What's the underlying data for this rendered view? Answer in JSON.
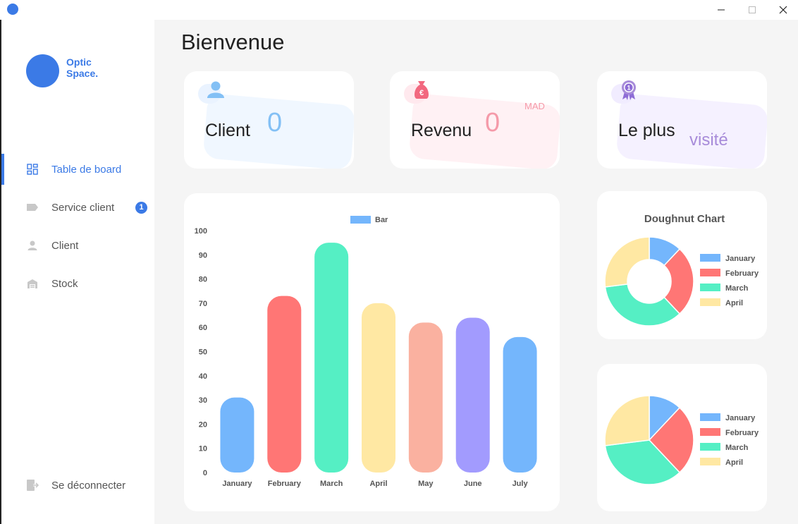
{
  "window": {
    "controls": [
      "minimize",
      "maximize",
      "close"
    ]
  },
  "brand": {
    "line1": "Optic",
    "line2": "Space.",
    "color": "#3b7ae6"
  },
  "sidebar": {
    "items": [
      {
        "label": "Table de board",
        "icon": "dashboard-icon",
        "active": true
      },
      {
        "label": "Service client",
        "icon": "tag-icon",
        "badge": "1"
      },
      {
        "label": "Client",
        "icon": "person-icon"
      },
      {
        "label": "Stock",
        "icon": "warehouse-icon"
      }
    ],
    "logout": {
      "label": "Se déconnecter",
      "icon": "logout-icon"
    }
  },
  "main": {
    "title": "Bienvenue",
    "stats": [
      {
        "label": "Client",
        "value": "0",
        "unit": "",
        "icon": "user-icon",
        "color": "#83c0f5"
      },
      {
        "label": "Revenu",
        "value": "0",
        "unit": "MAD",
        "icon": "money-bag-icon",
        "color": "#f59aa9"
      },
      {
        "label": "Le plus",
        "value": "visité",
        "unit": "",
        "icon": "award-icon",
        "color": "#a78bd9"
      }
    ]
  },
  "chart_data": [
    {
      "type": "bar",
      "legend": [
        "Bar"
      ],
      "categories": [
        "January",
        "February",
        "March",
        "April",
        "May",
        "June",
        "July"
      ],
      "series": [
        {
          "name": "Bar",
          "values": [
            31,
            73,
            95,
            70,
            62,
            64,
            56
          ]
        }
      ],
      "colors": [
        "#74b6fc",
        "#ff7675",
        "#55efc4",
        "#ffe8a3",
        "#fab1a0",
        "#a29bfe",
        "#74b6fc"
      ],
      "ylim": [
        0,
        100
      ],
      "yticks": [
        "100",
        "90",
        "80",
        "70",
        "60",
        "50",
        "40",
        "30",
        "20",
        "10",
        "0"
      ],
      "legend_position": "top"
    },
    {
      "type": "pie",
      "variant": "doughnut",
      "title": "Doughnut Chart",
      "categories": [
        "January",
        "February",
        "March",
        "April"
      ],
      "values": [
        12,
        26,
        35,
        27
      ],
      "colors": [
        "#74b6fc",
        "#ff7675",
        "#55efc4",
        "#ffe8a3"
      ],
      "legend_position": "right"
    },
    {
      "type": "pie",
      "categories": [
        "January",
        "February",
        "March",
        "April"
      ],
      "values": [
        12,
        26,
        35,
        27
      ],
      "colors": [
        "#74b6fc",
        "#ff7675",
        "#55efc4",
        "#ffe8a3"
      ],
      "legend_position": "right"
    }
  ]
}
